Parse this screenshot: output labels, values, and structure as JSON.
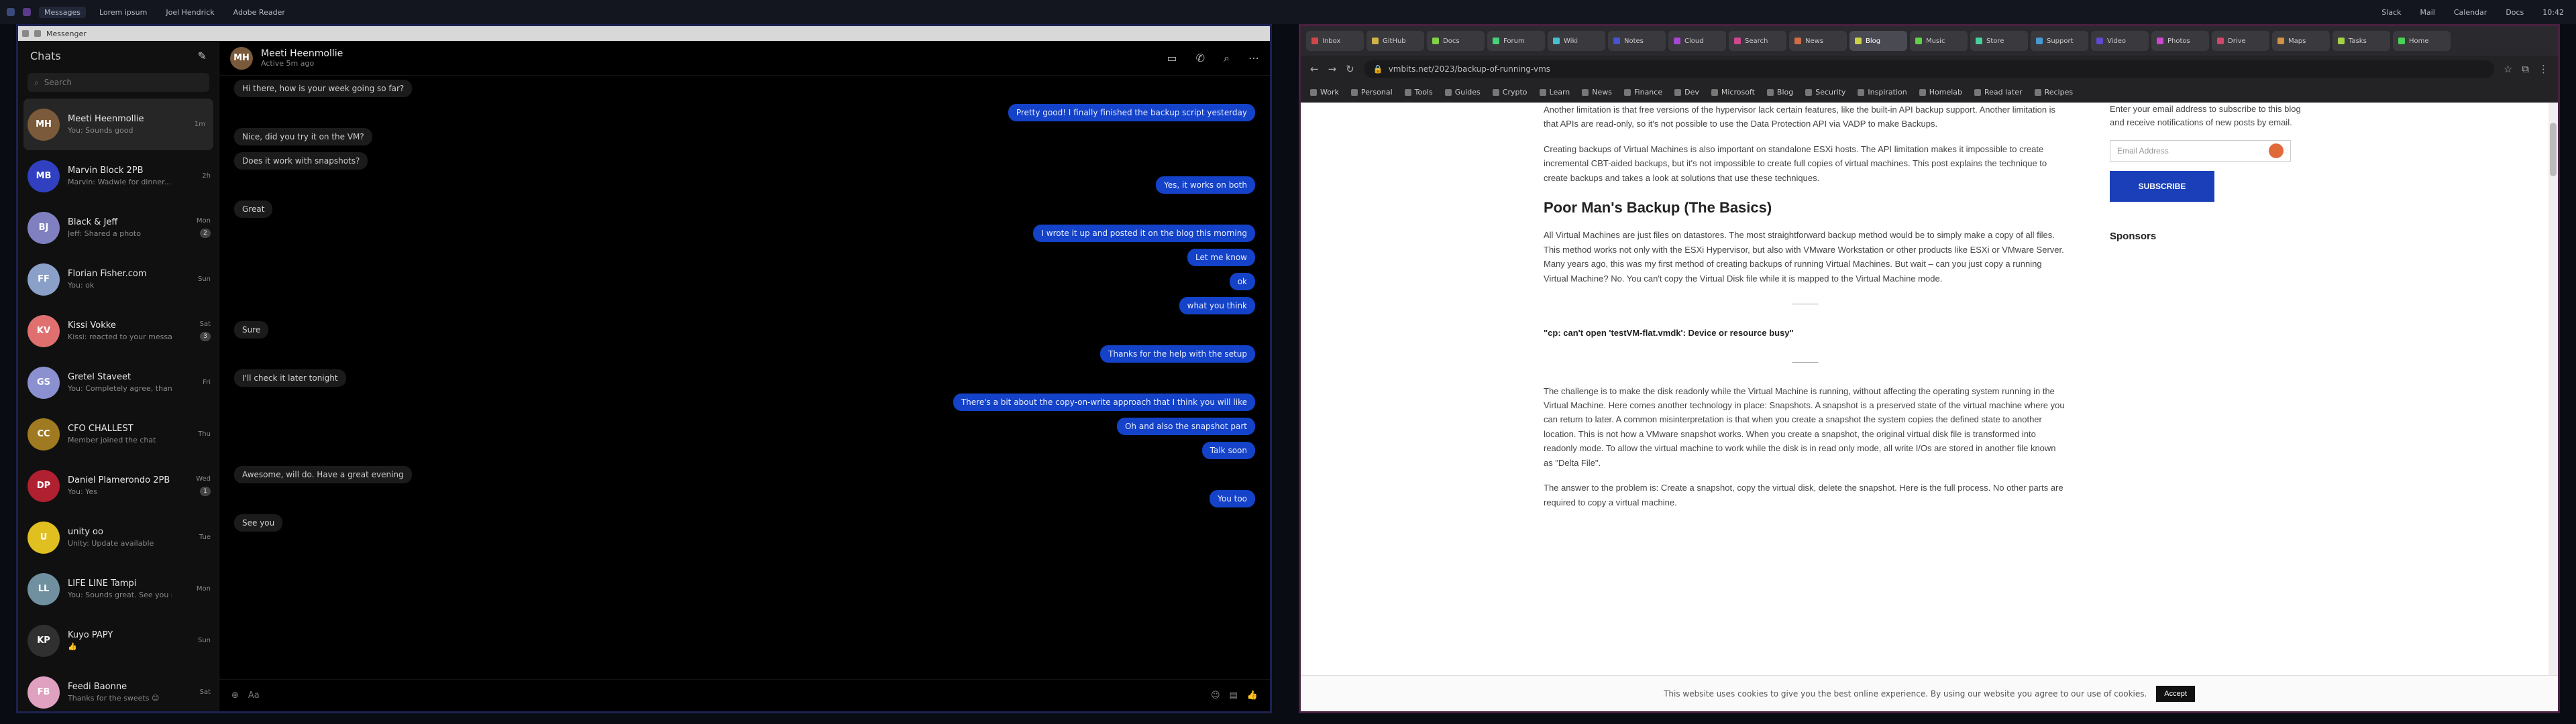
{
  "topbar": {
    "left_items": [
      "Messages",
      "Lorem ipsum",
      "Joel Hendrick",
      "Adobe Reader"
    ],
    "right_items": [
      "Slack",
      "Mail",
      "Calendar",
      "Docs"
    ],
    "clock": "10:42"
  },
  "messenger": {
    "window_title": "Messenger",
    "header_title": "Chats",
    "search_placeholder": "Search",
    "chats": [
      {
        "name": "Meeti Heenmollie",
        "preview": "You: Sounds good",
        "time": "1m",
        "badge": "",
        "avatar_text": "MH",
        "color": "#7a5a3a",
        "selected": true
      },
      {
        "name": "Marvin Block 2PB",
        "preview": "Marvin: Wadwie for dinner...",
        "time": "2h",
        "badge": "",
        "avatar_text": "MB",
        "color": "#3040c0"
      },
      {
        "name": "Black & Jeff",
        "preview": "Jeff: Shared a photo",
        "time": "Mon",
        "badge": "2",
        "avatar_text": "BJ",
        "color": "#8080c0"
      },
      {
        "name": "Florian Fisher.com",
        "preview": "You: ok",
        "time": "Sun",
        "badge": "",
        "avatar_text": "FF",
        "color": "#8aa0c8"
      },
      {
        "name": "Kissi Vokke",
        "preview": "Kissi: reacted to your message",
        "time": "Sat",
        "badge": "3",
        "avatar_text": "KV",
        "color": "#e07070"
      },
      {
        "name": "Gretel Staveet",
        "preview": "You: Completely agree, thanks a lot",
        "time": "Fri",
        "badge": "",
        "avatar_text": "GS",
        "color": "#8a90d0"
      },
      {
        "name": "CFO CHALLEST",
        "preview": "Member joined the chat",
        "time": "Thu",
        "badge": "",
        "avatar_text": "CC",
        "color": "#a07a20"
      },
      {
        "name": "Daniel Plamerondo 2PB",
        "preview": "You: Yes",
        "time": "Wed",
        "badge": "1",
        "avatar_text": "DP",
        "color": "#b02030"
      },
      {
        "name": "unity oo",
        "preview": "Unity: Update available",
        "time": "Tue",
        "badge": "",
        "avatar_text": "U",
        "color": "#e0c020"
      },
      {
        "name": "LIFE LINE Tampi",
        "preview": "You: Sounds great. See you soon",
        "time": "Mon",
        "badge": "",
        "avatar_text": "LL",
        "color": "#7090a0"
      },
      {
        "name": "Kuyo PAPY",
        "preview": "👍",
        "time": "Sun",
        "badge": "",
        "avatar_text": "KP",
        "color": "#303030"
      },
      {
        "name": "Feedi Baonne",
        "preview": "Thanks for the sweets 😊",
        "time": "Sat",
        "badge": "",
        "avatar_text": "FB",
        "color": "#e0a0c0"
      }
    ],
    "conversation": {
      "name": "Meeti Heenmollie",
      "status": "Active 5m ago",
      "composer_placeholder": "Aa",
      "messages": [
        {
          "dir": "in",
          "text": "Hi there, how is your week going so far?"
        },
        {
          "dir": "out",
          "text": "Pretty good! I finally finished the backup script yesterday"
        },
        {
          "dir": "in",
          "text": "Nice, did you try it on the VM?"
        },
        {
          "dir": "in",
          "text": "Does it work with snapshots?"
        },
        {
          "dir": "out",
          "text": "Yes, it works on both"
        },
        {
          "dir": "in",
          "text": "Great"
        },
        {
          "dir": "out",
          "text": "I wrote it up and posted it on the blog this morning"
        },
        {
          "dir": "out",
          "text": "Let me know"
        },
        {
          "dir": "out",
          "text": "ok"
        },
        {
          "dir": "out",
          "text": "what you think"
        },
        {
          "dir": "in",
          "text": "Sure"
        },
        {
          "dir": "out",
          "text": "Thanks for the help with the setup"
        },
        {
          "dir": "in",
          "text": "I'll check it later tonight"
        },
        {
          "dir": "out",
          "text": "There's a bit about the copy-on-write approach that I think you will like"
        },
        {
          "dir": "out",
          "text": "Oh and also the snapshot part"
        },
        {
          "dir": "out",
          "text": "Talk soon"
        },
        {
          "dir": "in",
          "text": "Awesome, will do. Have a great evening"
        },
        {
          "dir": "out",
          "text": "You too"
        },
        {
          "dir": "in",
          "text": "See you"
        }
      ]
    }
  },
  "browser": {
    "tabs": [
      "Inbox",
      "GitHub",
      "Docs",
      "Forum",
      "Wiki",
      "Notes",
      "Cloud",
      "Search",
      "News",
      "Blog",
      "Music",
      "Store",
      "Support",
      "Video",
      "Photos",
      "Drive",
      "Maps",
      "Tasks",
      "Home"
    ],
    "active_tab": 9,
    "url": "vmbits.net/2023/backup-of-running-vms",
    "bookmarks": [
      "Work",
      "Personal",
      "Tools",
      "Guides",
      "Crypto",
      "Learn",
      "News",
      "Finance",
      "Dev",
      "Microsoft",
      "Blog",
      "Security",
      "Inspiration",
      "Homelab",
      "Read later",
      "Recipes"
    ],
    "article": {
      "p0": "Another limitation is that free versions of the hypervisor lack certain features, like the built-in API backup support. Another limitation is that APIs are read-only, so it's not possible to use the Data Protection API via VADP to make Backups.",
      "p1": "Creating backups of Virtual Machines is also important on standalone ESXi hosts. The API limitation makes it impossible to create incremental CBT-aided backups, but it's not impossible to create full copies of virtual machines. This post explains the technique to create backups and takes a look at solutions that use these techniques.",
      "h2": "Poor Man's Backup (The Basics)",
      "p2": "All Virtual Machines are just files on datastores. The most straightforward backup method would be to simply make a copy of all files. This method works not only with the ESXi Hypervisor, but also with VMware Workstation or other products like ESXi or VMware Server. Many years ago, this was my first method of creating backups of running Virtual Machines. But wait – can you just copy a running Virtual Machine? No. You can't copy the Virtual Disk file while it is mapped to the Virtual Machine mode.",
      "sep": "———",
      "err": "\"cp: can't open 'testVM-flat.vmdk': Device or resource busy\"",
      "p3": "The challenge is to make the disk readonly while the Virtual Machine is running, without affecting the operating system running in the Virtual Machine. Here comes another technology in place: Snapshots. A snapshot is a preserved state of the virtual machine where you can return to later. A common misinterpretation is that when you create a snapshot the system copies the defined state to another location. This is not how a VMware snapshot works. When you create a snapshot, the original virtual disk file is transformed into readonly mode. To allow the virtual machine to work while the disk is in read only mode, all write I/Os are stored in another file known as \"Delta File\".",
      "p4": "The answer to the problem is: Create a snapshot, copy the virtual disk, delete the snapshot. Here is the full process. No other parts are required to copy a virtual machine."
    },
    "aside": {
      "subscribe_text": "Enter your email address to subscribe to this blog and receive notifications of new posts by email.",
      "email_placeholder": "Email Address",
      "subscribe_button": "SUBSCRIBE",
      "sponsors_heading": "Sponsors"
    },
    "cookie": {
      "text": "This website uses cookies to give you the best online experience. By using our website you agree to our use of cookies.",
      "button": "Accept"
    }
  }
}
